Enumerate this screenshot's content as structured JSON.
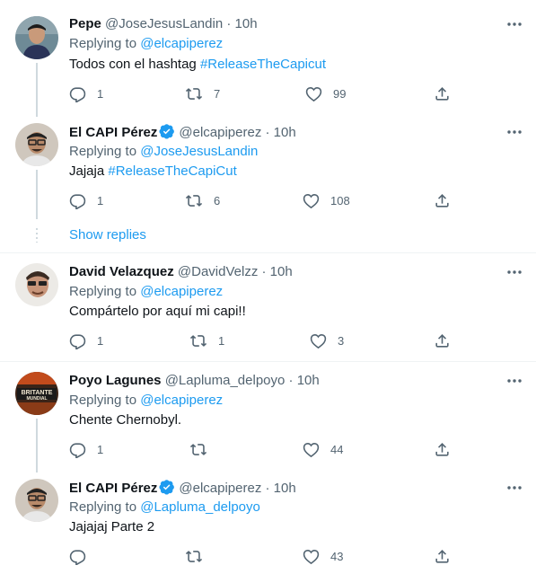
{
  "tweets": [
    {
      "name": "Pepe",
      "handle": "@JoseJesusLandin",
      "time": "10h",
      "replying_label": "Replying to",
      "replying_to": "@elcapiperez",
      "text": "Todos con el hashtag ",
      "hashtag": "#ReleaseTheCapicut",
      "replies": "1",
      "retweets": "7",
      "likes": "99",
      "verified": false
    },
    {
      "name": "El CAPI Pérez",
      "handle": "@elcapiperez",
      "time": "10h",
      "replying_label": "Replying to",
      "replying_to": "@JoseJesusLandin",
      "text": "Jajaja ",
      "hashtag": "#ReleaseTheCapiCut",
      "replies": "1",
      "retweets": "6",
      "likes": "108",
      "verified": true
    },
    {
      "name": "David Velazquez",
      "handle": "@DavidVelzz",
      "time": "10h",
      "replying_label": "Replying to",
      "replying_to": "@elcapiperez",
      "text": "Compártelo por aquí mi capi!!",
      "hashtag": "",
      "replies": "1",
      "retweets": "1",
      "likes": "3",
      "verified": false
    },
    {
      "name": "Poyo Lagunes",
      "handle": "@Lapluma_delpoyo",
      "time": "10h",
      "replying_label": "Replying to",
      "replying_to": "@elcapiperez",
      "text": "Chente Chernobyl.",
      "hashtag": "",
      "replies": "1",
      "retweets": "",
      "likes": "44",
      "verified": false,
      "avatar_text_top": "BRITANTE",
      "avatar_text_bottom": "MUNDIAL"
    },
    {
      "name": "El CAPI Pérez",
      "handle": "@elcapiperez",
      "time": "10h",
      "replying_label": "Replying to",
      "replying_to": "@Lapluma_delpoyo",
      "text": "Jajajaj Parte 2",
      "hashtag": "",
      "replies": "",
      "retweets": "",
      "likes": "43",
      "verified": true
    }
  ],
  "show_replies": "Show replies",
  "separator": "·",
  "icons": {
    "reply": "reply-icon",
    "retweet": "retweet-icon",
    "like": "heart-icon",
    "share": "share-icon",
    "more": "more-icon",
    "verified": "verified-badge-icon"
  },
  "colors": {
    "link": "#1d9bf0",
    "secondary": "#536471",
    "verified": "#1d9bf0"
  }
}
